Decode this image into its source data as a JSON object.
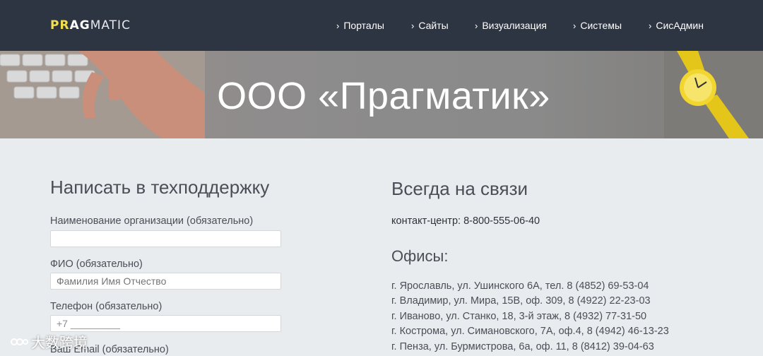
{
  "header": {
    "logo": {
      "part1": "PR",
      "part2": "AG",
      "part3": "MATIC"
    },
    "nav": [
      {
        "label": "Порталы"
      },
      {
        "label": "Сайты"
      },
      {
        "label": "Визуализация"
      },
      {
        "label": "Системы"
      },
      {
        "label": "СисАдмин"
      }
    ]
  },
  "hero": {
    "title": "ООО «Прагматик»"
  },
  "form": {
    "heading": "Написать в техподдержку",
    "fields": [
      {
        "label": "Наименование организации (обязательно)",
        "value": "",
        "placeholder": ""
      },
      {
        "label": "ФИО (обязательно)",
        "value": "",
        "placeholder": "Фамилия Имя Отчество"
      },
      {
        "label": "Телефон (обязательно)",
        "value": "+7 _________",
        "placeholder": ""
      },
      {
        "label": "Ваш Email (обязательно)"
      }
    ]
  },
  "contacts": {
    "heading": "Всегда на связи",
    "contact_center": "контакт-центр: 8-800-555-06-40",
    "offices_heading": "Офисы:",
    "offices": [
      "г. Ярославль, ул. Ушинского 6А, тел. 8 (4852) 69-53-04",
      "г. Владимир, ул. Мира, 15В, оф. 309, 8 (4922) 22-23-03",
      "г. Иваново, ул. Станко, 18, 3-й этаж, 8 (4932) 77-31-50",
      "г. Кострома, ул. Симановского, 7А, оф.4, 8 (4942) 46-13-23",
      "г. Пенза, ул. Бурмистрова, 6а, оф. 11, 8 (8412) 39-04-63"
    ]
  },
  "watermark": {
    "text": "大数跨境"
  },
  "colors": {
    "header_bg": "#2e3542",
    "logo_accent": "#f4e04d",
    "page_bg": "#e9ecef"
  }
}
